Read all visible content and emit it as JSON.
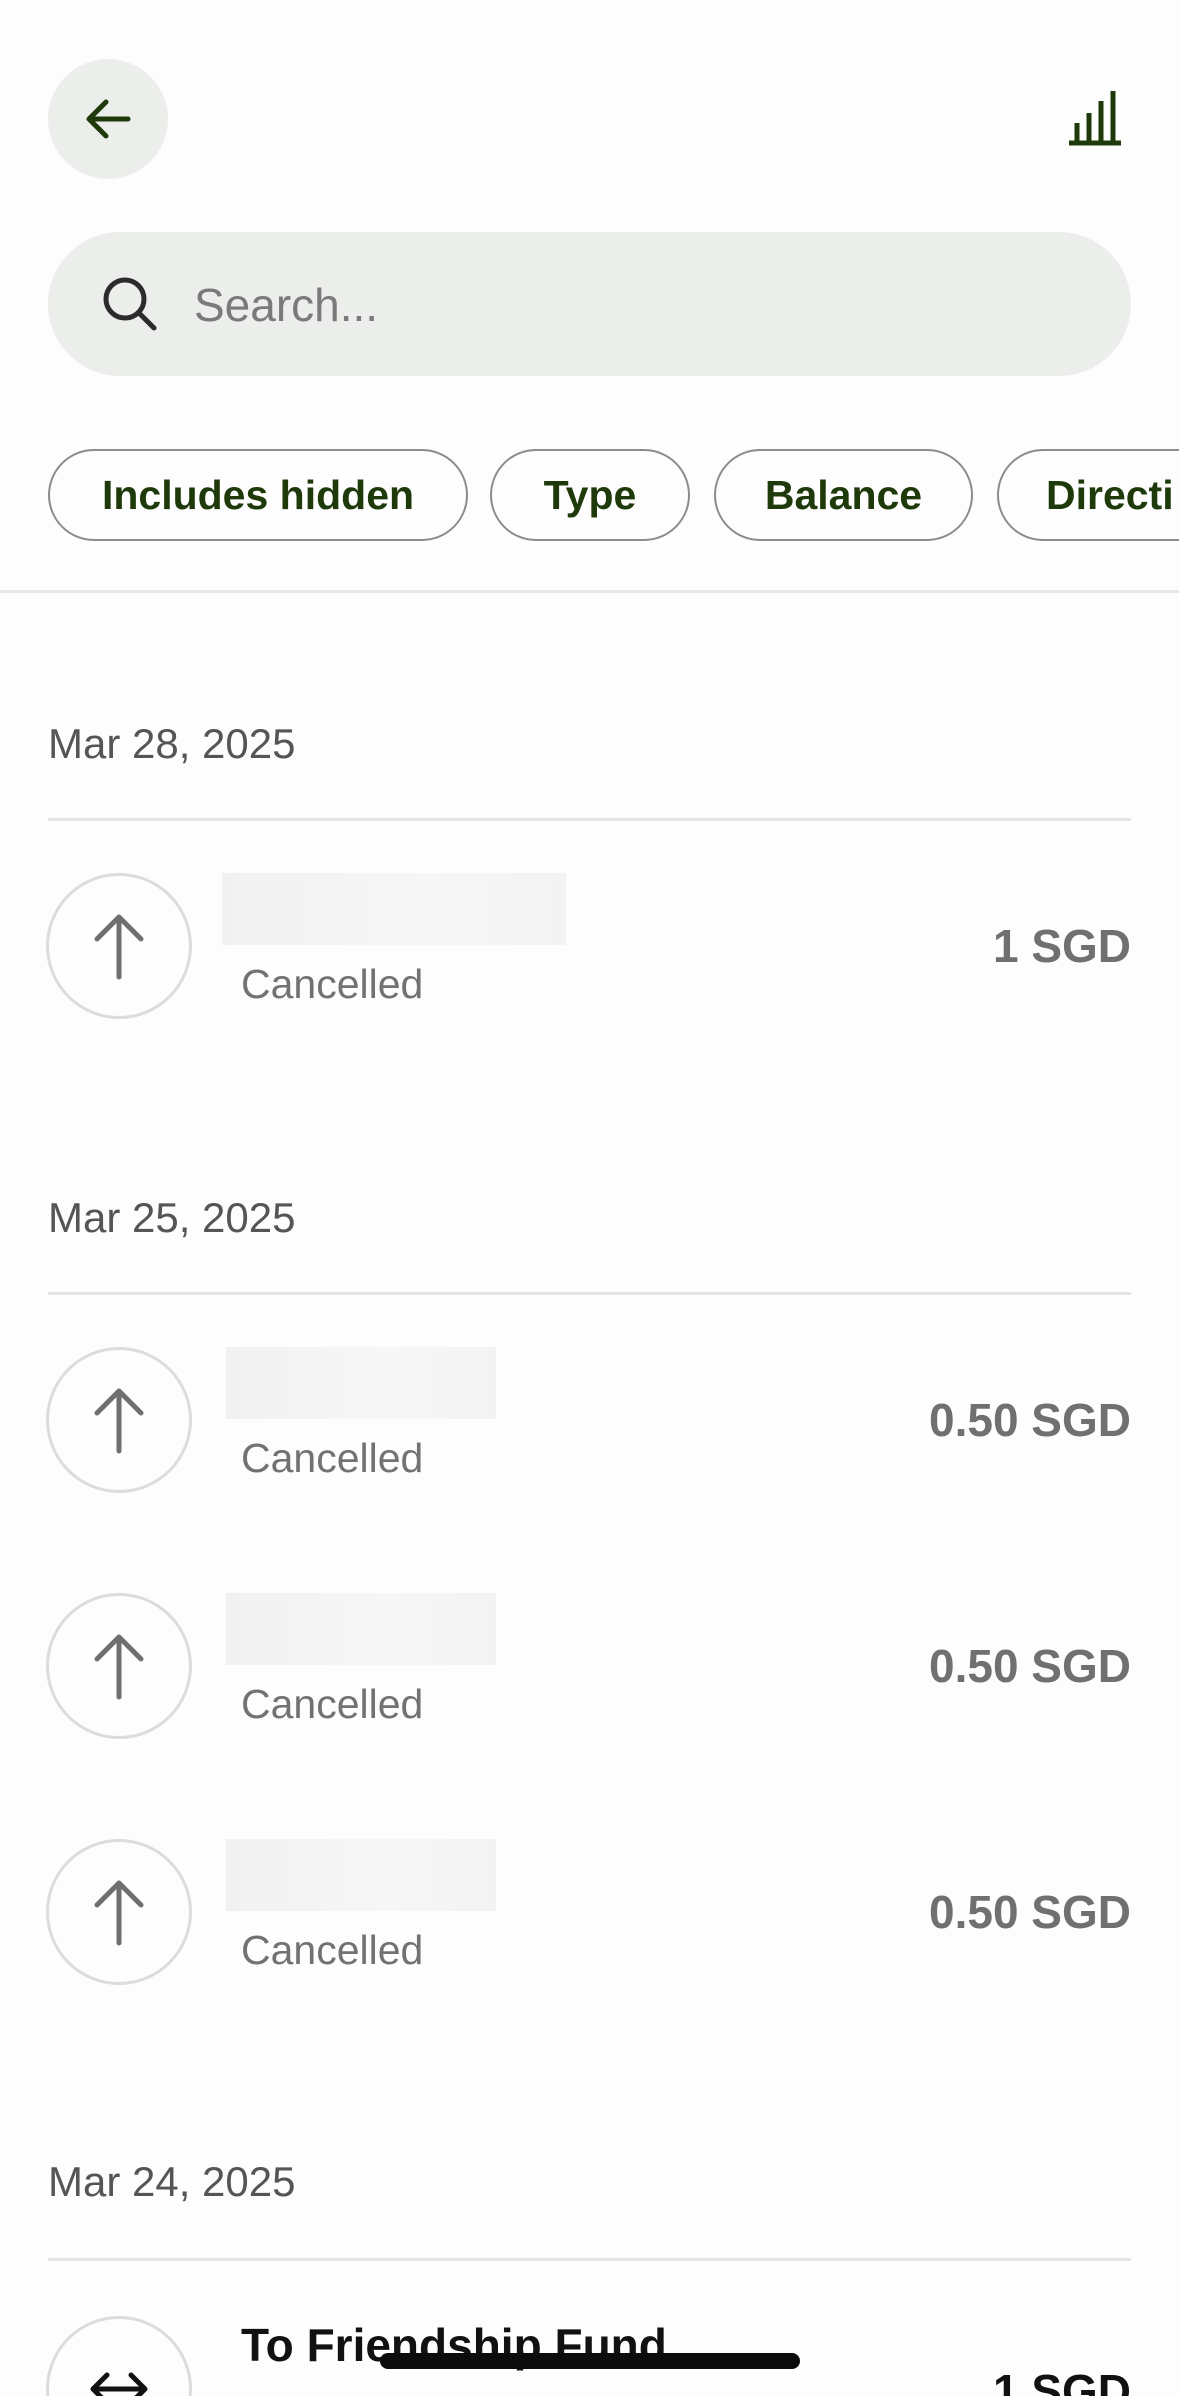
{
  "header": {
    "back_icon": "arrow-left-icon",
    "stats_icon": "bar-chart-icon",
    "accent_color": "#1f3a0a"
  },
  "search": {
    "placeholder": "Search...",
    "value": "",
    "icon": "search-icon"
  },
  "filters": [
    {
      "label": "Includes hidden"
    },
    {
      "label": "Type"
    },
    {
      "label": "Balance"
    },
    {
      "label": "Directi"
    }
  ],
  "groups": [
    {
      "date": "Mar 28, 2025",
      "transactions": [
        {
          "icon": "arrow-up-icon",
          "title": "",
          "status": "Cancelled",
          "amount": "1 SGD"
        }
      ]
    },
    {
      "date": "Mar 25, 2025",
      "transactions": [
        {
          "icon": "arrow-up-icon",
          "title": "",
          "status": "Cancelled",
          "amount": "0.50 SGD"
        },
        {
          "icon": "arrow-up-icon",
          "title": "",
          "status": "Cancelled",
          "amount": "0.50 SGD"
        },
        {
          "icon": "arrow-up-icon",
          "title": "",
          "status": "Cancelled",
          "amount": "0.50 SGD"
        }
      ]
    },
    {
      "date": "Mar 24, 2025",
      "transactions": [
        {
          "icon": "transfer-arrows-icon",
          "title": "To Friendship Fund",
          "status": "",
          "amount": "1 SGD"
        }
      ]
    }
  ]
}
